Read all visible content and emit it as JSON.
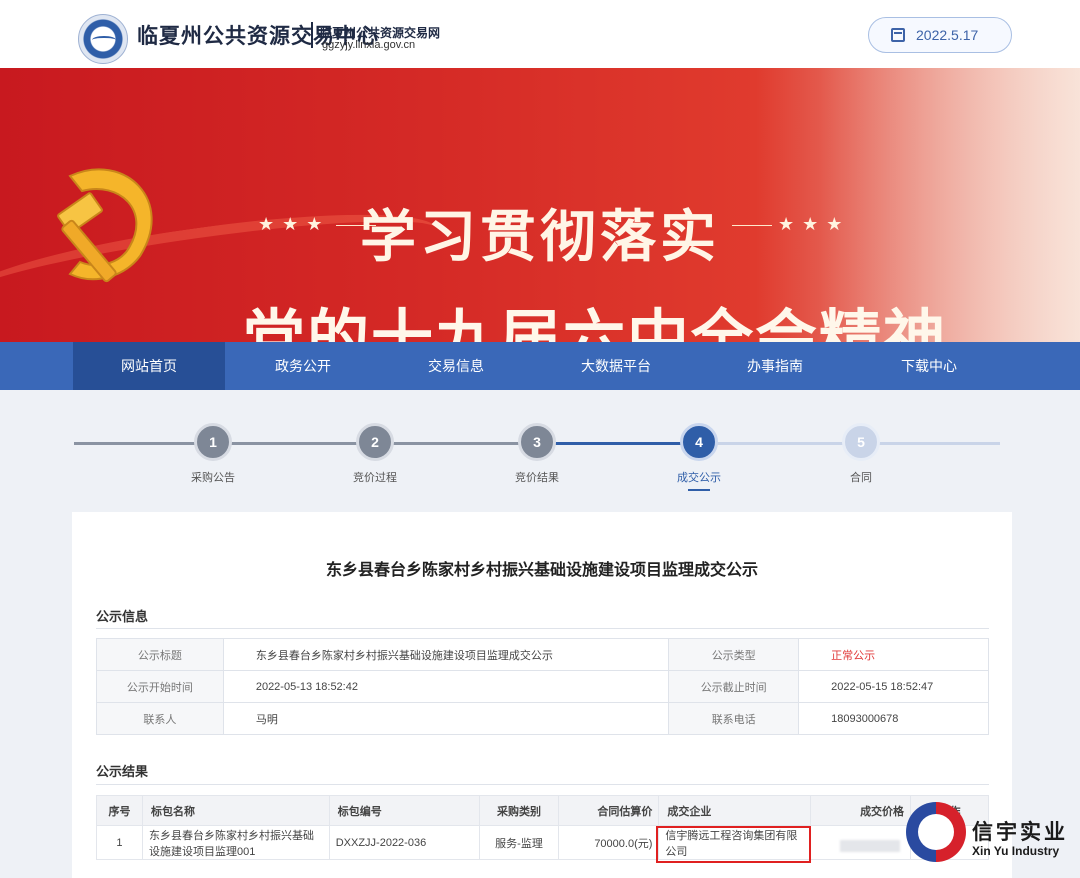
{
  "header": {
    "site_title": "临夏州公共资源交易中心",
    "site_subtitle": "临夏州公共资源交易网",
    "site_url": "ggzyjy.linxia.gov.cn",
    "date": "2022.5.17"
  },
  "banner": {
    "headline_1": "学习贯彻落实",
    "headline_2": "党的十九届六中全会精神",
    "stars_left": "★★★",
    "stars_right": "★★★",
    "slide_count": 7,
    "active_slide": 1
  },
  "nav": {
    "items": [
      {
        "label": "网站首页",
        "active": true
      },
      {
        "label": "政务公开"
      },
      {
        "label": "交易信息"
      },
      {
        "label": "大数据平台"
      },
      {
        "label": "办事指南"
      },
      {
        "label": "下载中心"
      }
    ]
  },
  "steps": [
    {
      "num": "1",
      "label": "采购公告",
      "state": "done"
    },
    {
      "num": "2",
      "label": "竞价过程",
      "state": "done"
    },
    {
      "num": "3",
      "label": "竞价结果",
      "state": "done"
    },
    {
      "num": "4",
      "label": "成交公示",
      "state": "active"
    },
    {
      "num": "5",
      "label": "合同",
      "state": "future"
    }
  ],
  "main": {
    "page_title": "东乡县春台乡陈家村乡村振兴基础设施建设项目监理成交公示",
    "info_section_title": "公示信息",
    "info": {
      "title_label": "公示标题",
      "title_value": "东乡县春台乡陈家村乡村振兴基础设施建设项目监理成交公示",
      "type_label": "公示类型",
      "type_value": "正常公示",
      "start_label": "公示开始时间",
      "start_value": "2022-05-13 18:52:42",
      "end_label": "公示截止时间",
      "end_value": "2022-05-15 18:52:47",
      "contact_label": "联系人",
      "contact_value": "马明",
      "phone_label": "联系电话",
      "phone_value": "18093000678"
    },
    "result_section_title": "公示结果",
    "result_headers": [
      "序号",
      "标包名称",
      "标包编号",
      "采购类别",
      "合同估算价",
      "成交企业",
      "成交价格",
      "操作"
    ],
    "result_rows": [
      {
        "no": "1",
        "name": "东乡县春台乡陈家村乡村振兴基础设施建设项目监理001",
        "code": "DXXZJJ-2022-036",
        "category": "服务-监理",
        "estimate": "70000.0(元)",
        "company": "信宇腾远工程咨询集团有限公司"
      }
    ]
  },
  "watermark": {
    "cn": "信宇实业",
    "en": "Xin Yu Industry"
  },
  "colors": {
    "nav_bg": "#3a68b8",
    "nav_active": "#274f96",
    "accent": "#2f5ea8",
    "status_red": "#e13a3a",
    "banner_red": "#c8191f"
  }
}
